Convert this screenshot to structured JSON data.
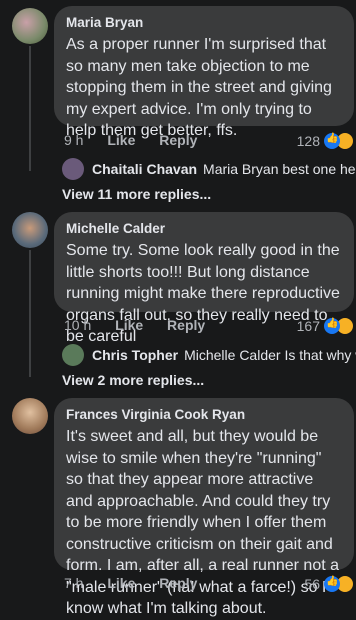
{
  "comments": [
    {
      "author": "Maria Bryan",
      "text": "As a proper runner I'm surprised that so many men take objection to me stopping them in the street and giving my expert advice. I'm only trying to help them get better, ffs.",
      "time": "9 h",
      "like": "Like",
      "reply": "Reply",
      "reaction_count": "128",
      "preview_reply": {
        "author": "Chaitali Chavan",
        "text": "Maria Bryan best one here😂..."
      },
      "more_replies": "View 11 more replies..."
    },
    {
      "author": "Michelle Calder",
      "text": "Some try. Some look really good in the little shorts too!!! But long distance running might make there reproductive organs fall out, so they really need to be careful",
      "time": "10 h",
      "like": "Like",
      "reply": "Reply",
      "reaction_count": "167",
      "preview_reply": {
        "author": "Chris Topher",
        "text": "Michelle Calder Is that why wome..."
      },
      "more_replies": "View 2 more replies..."
    },
    {
      "author": "Frances Virginia Cook Ryan",
      "text": "It's sweet and all, but they would be wise to smile when they're \"running\" so that they appear more attractive and approachable. And could they try to be more friendly when I offer them constructive criticism on their gait and form. I am, after all, a real runner not a \"male runner\" (ha! what a farce!) so I know what I'm talking about.",
      "time": "7 h",
      "like": "Like",
      "reply": "Reply",
      "reaction_count": "56"
    }
  ],
  "colors": {
    "background": "#18191a",
    "bubble": "#3a3b3c",
    "like_blue": "#1877f2",
    "haha_yellow": "#f7b125"
  }
}
